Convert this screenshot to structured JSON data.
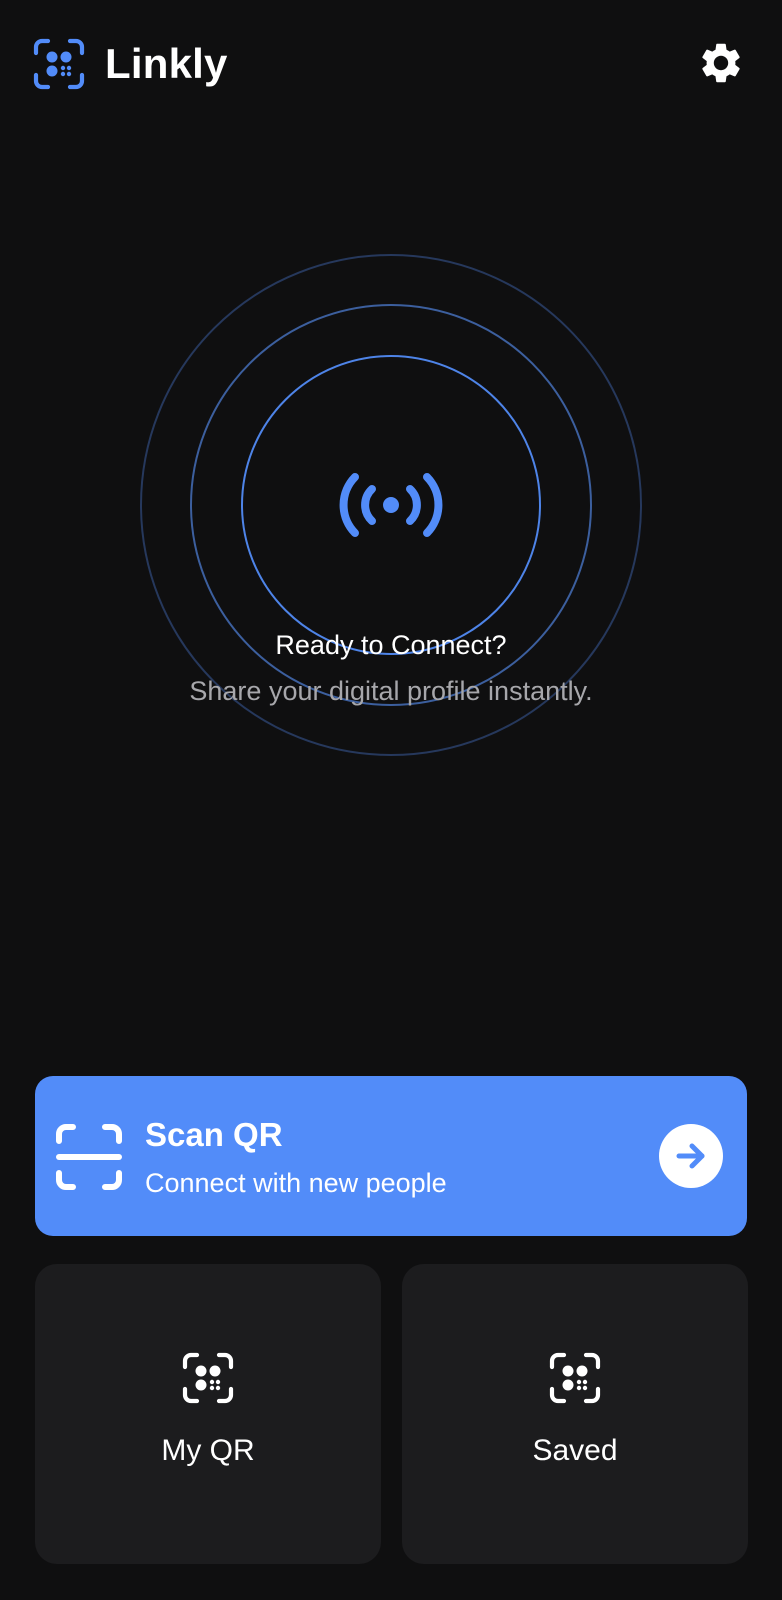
{
  "app": {
    "title": "Linkly",
    "logo_icon": "qr-scan-icon",
    "settings_icon": "gear-icon"
  },
  "status": {
    "title": "Ready to Connect?",
    "subtitle": "Share your digital profile instantly.",
    "icon": "broadcast-icon"
  },
  "scan_card": {
    "title": "Scan QR",
    "subtitle": "Connect with new people",
    "icon": "scan-frame-icon",
    "action_icon": "arrow-right-icon"
  },
  "tiles": [
    {
      "label": "My QR",
      "icon": "qr-scan-icon"
    },
    {
      "label": "Saved",
      "icon": "qr-scan-icon"
    }
  ],
  "colors": {
    "background": "#0f0f10",
    "accent": "#528cf9",
    "tile": "#1c1c1e",
    "muted_text": "#a7a7ab"
  }
}
